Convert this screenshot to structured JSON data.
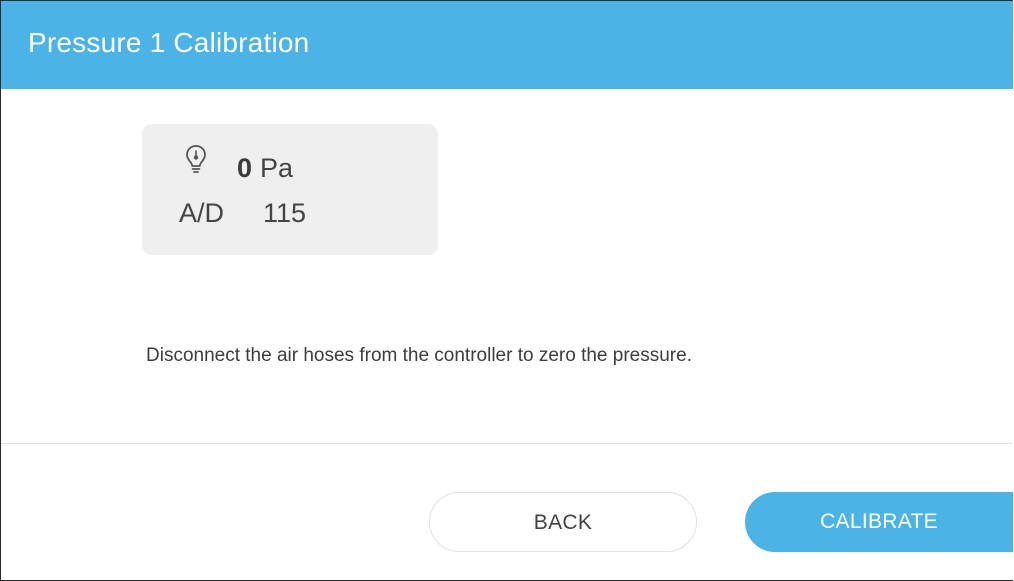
{
  "dialog": {
    "title": "Pressure 1 Calibration"
  },
  "sensor": {
    "icon": "pressure-gauge-icon",
    "pressure_value": "0",
    "pressure_unit": "Pa",
    "ad_label": "A/D",
    "ad_value": "115"
  },
  "instruction": "Disconnect the air hoses from the controller to zero the pressure.",
  "buttons": {
    "back_label": "BACK",
    "calibrate_label": "CALIBRATE"
  },
  "colors": {
    "accent": "#4cb3e7",
    "card_background": "#efefef"
  }
}
